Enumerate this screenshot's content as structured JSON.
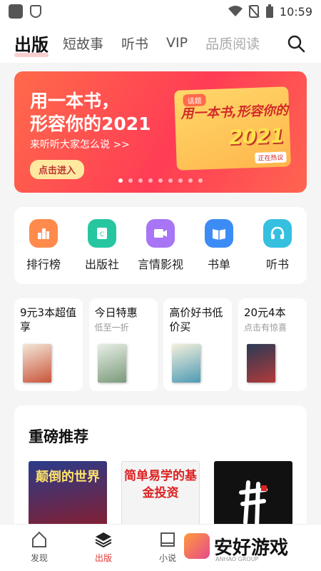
{
  "status_bar": {
    "time": "10:59"
  },
  "top_nav": {
    "tabs": [
      {
        "label": "出版"
      },
      {
        "label": "短故事"
      },
      {
        "label": "听书"
      },
      {
        "label": "VIP"
      },
      {
        "label": "品质阅读"
      }
    ]
  },
  "banner": {
    "title_line1": "用一本书，",
    "title_line2": "形容你的2021",
    "subtitle": "来听听大家怎么说 >>",
    "cta": "点击进入",
    "card_tag": "话题",
    "card_text": "用一本书,形容你的",
    "card_year": "2021",
    "card_live": "正在热议"
  },
  "quick_links": [
    {
      "label": "排行榜",
      "icon": "trophy-icon",
      "color": "#ff8a4c"
    },
    {
      "label": "出版社",
      "icon": "publisher-icon",
      "color": "#26c6a0"
    },
    {
      "label": "言情影视",
      "icon": "video-icon",
      "color": "#a775f5"
    },
    {
      "label": "书单",
      "icon": "booklist-icon",
      "color": "#3d8bf5"
    },
    {
      "label": "听书",
      "icon": "headphones-icon",
      "color": "#35c0e0"
    }
  ],
  "deals": [
    {
      "title": "9元3本超值享",
      "subtitle": ""
    },
    {
      "title": "今日特惠",
      "subtitle": "低至一折"
    },
    {
      "title": "高价好书低价买",
      "subtitle": ""
    },
    {
      "title": "20元4本",
      "subtitle": "点击有惊喜"
    }
  ],
  "featured": {
    "title": "重磅推荐",
    "books": [
      {
        "title": "颠倒的世界"
      },
      {
        "title": "简单易学的基金投资"
      },
      {
        "title": ""
      }
    ]
  },
  "bottom_nav": [
    {
      "label": "发现",
      "icon": "discover-icon"
    },
    {
      "label": "出版",
      "icon": "layers-icon"
    },
    {
      "label": "小说",
      "icon": "book-icon"
    }
  ],
  "watermark": {
    "text": "安好游戏",
    "small": "ANHAO GROUP"
  }
}
